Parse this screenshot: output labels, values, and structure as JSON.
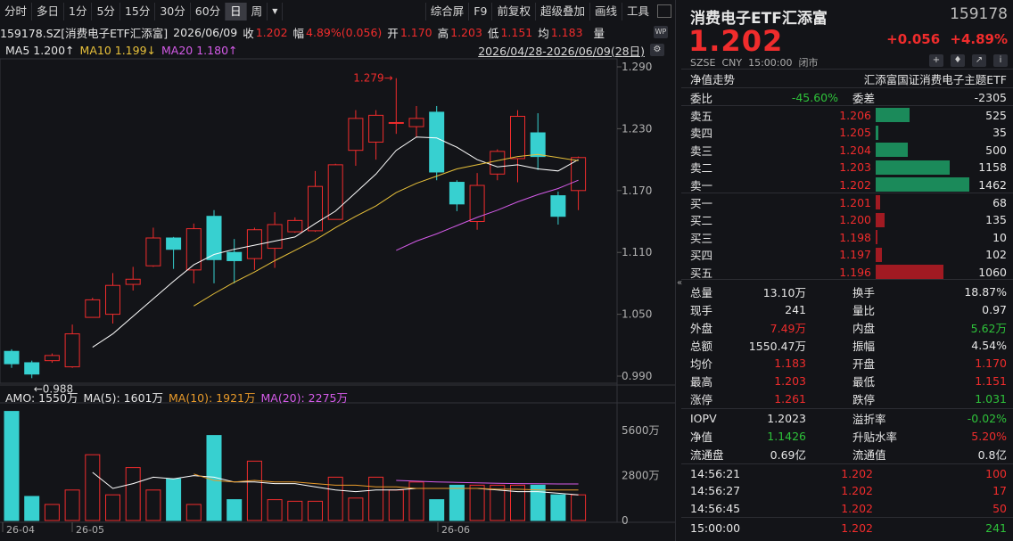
{
  "toolbar": {
    "left": [
      "分时",
      "多日",
      "1分",
      "5分",
      "15分",
      "30分",
      "60分",
      "日",
      "周"
    ],
    "active": "日",
    "right": [
      "综合屏",
      "F9",
      "前复权",
      "超级叠加",
      "画线",
      "工具"
    ]
  },
  "info": {
    "code": "159178.SZ[消费电子ETF汇添富]",
    "date": "2026/06/09",
    "close_label": "收",
    "close": "1.202",
    "amp_label": "幅",
    "amp": "4.89%(0.056)",
    "open_label": "开",
    "open": "1.170",
    "high_label": "高",
    "high": "1.203",
    "low_label": "低",
    "low": "1.151",
    "avg_label": "均",
    "avg": "1.183",
    "vol_label": "量"
  },
  "ma": {
    "ma5": "MA5 1.200↑",
    "ma10": "MA10 1.199↓",
    "ma20": "MA20 1.180↑",
    "range": "2026/04/28-2026/06/09(28日)"
  },
  "amo": {
    "amo": "AMO: 1550万",
    "ma5": "MA(5): 1601万",
    "ma10": "MA(10): 1921万",
    "ma20": "MA(20): 2275万"
  },
  "chart_data": {
    "type": "candlestick",
    "price_axis": [
      "1.290",
      "1.230",
      "1.170",
      "1.110",
      "1.050",
      "0.990"
    ],
    "ylim": [
      0.96,
      1.3
    ],
    "vol_axis": [
      "5600万",
      "2800万",
      "0"
    ],
    "vol_ylim": [
      0,
      7000
    ],
    "x_labels": [
      "26-04",
      "26-05",
      "26-06"
    ],
    "annotations": {
      "high": "1.279",
      "low": "0.988"
    },
    "candles": [
      {
        "o": 1.014,
        "c": 1.002,
        "h": 1.016,
        "l": 0.998
      },
      {
        "o": 1.003,
        "c": 0.992,
        "h": 1.005,
        "l": 0.988
      },
      {
        "o": 1.005,
        "c": 1.01,
        "h": 1.012,
        "l": 1.003
      },
      {
        "o": 0.999,
        "c": 1.031,
        "h": 1.04,
        "l": 0.998
      },
      {
        "o": 1.047,
        "c": 1.064,
        "h": 1.066,
        "l": 1.047
      },
      {
        "o": 1.05,
        "c": 1.078,
        "h": 1.09,
        "l": 1.041
      },
      {
        "o": 1.079,
        "c": 1.084,
        "h": 1.096,
        "l": 1.073
      },
      {
        "o": 1.097,
        "c": 1.124,
        "h": 1.134,
        "l": 1.096
      },
      {
        "o": 1.124,
        "c": 1.113,
        "h": 1.125,
        "l": 1.094
      },
      {
        "o": 1.093,
        "c": 1.133,
        "h": 1.138,
        "l": 1.08
      },
      {
        "o": 1.145,
        "c": 1.103,
        "h": 1.151,
        "l": 1.08
      },
      {
        "o": 1.11,
        "c": 1.102,
        "h": 1.123,
        "l": 1.08
      },
      {
        "o": 1.104,
        "c": 1.132,
        "h": 1.134,
        "l": 1.093
      },
      {
        "o": 1.114,
        "c": 1.137,
        "h": 1.149,
        "l": 1.095
      },
      {
        "o": 1.13,
        "c": 1.141,
        "h": 1.144,
        "l": 1.129
      },
      {
        "o": 1.131,
        "c": 1.174,
        "h": 1.189,
        "l": 1.13
      },
      {
        "o": 1.142,
        "c": 1.195,
        "h": 1.196,
        "l": 1.142
      },
      {
        "o": 1.209,
        "c": 1.24,
        "h": 1.248,
        "l": 1.194
      },
      {
        "o": 1.217,
        "c": 1.243,
        "h": 1.248,
        "l": 1.2
      },
      {
        "o": 1.236,
        "c": 1.236,
        "h": 1.279,
        "l": 1.225
      },
      {
        "o": 1.232,
        "c": 1.24,
        "h": 1.252,
        "l": 1.222
      },
      {
        "o": 1.246,
        "c": 1.188,
        "h": 1.252,
        "l": 1.18
      },
      {
        "o": 1.178,
        "c": 1.157,
        "h": 1.18,
        "l": 1.15
      },
      {
        "o": 1.14,
        "c": 1.175,
        "h": 1.187,
        "l": 1.132
      },
      {
        "o": 1.186,
        "c": 1.208,
        "h": 1.21,
        "l": 1.18
      },
      {
        "o": 1.201,
        "c": 1.242,
        "h": 1.248,
        "l": 1.178
      },
      {
        "o": 1.226,
        "c": 1.203,
        "h": 1.245,
        "l": 1.19
      },
      {
        "o": 1.165,
        "c": 1.145,
        "h": 1.169,
        "l": 1.137
      },
      {
        "o": 1.17,
        "c": 1.202,
        "h": 1.203,
        "l": 1.151
      }
    ],
    "volumes": [
      6800,
      1500,
      1000,
      1900,
      4100,
      1600,
      3300,
      1900,
      2600,
      1000,
      5300,
      1300,
      3700,
      1300,
      1200,
      1200,
      2700,
      1400,
      2700,
      1900,
      2400,
      1300,
      2200,
      2200,
      2200,
      2200,
      2200,
      1600,
      1600
    ],
    "ma5": [
      null,
      null,
      null,
      null,
      1.018,
      1.031,
      1.048,
      1.065,
      1.082,
      1.098,
      1.108,
      1.113,
      1.117,
      1.121,
      1.125,
      1.138,
      1.15,
      1.168,
      1.186,
      1.209,
      1.222,
      1.221,
      1.212,
      1.2,
      1.193,
      1.195,
      1.191,
      1.189,
      1.2
    ],
    "ma10": [
      null,
      null,
      null,
      null,
      null,
      null,
      null,
      null,
      null,
      1.058,
      1.07,
      1.081,
      1.091,
      1.102,
      1.112,
      1.122,
      1.134,
      1.145,
      1.155,
      1.168,
      1.177,
      1.184,
      1.191,
      1.195,
      1.199,
      1.203,
      1.205,
      1.202,
      1.199
    ],
    "ma20": [
      null,
      null,
      null,
      null,
      null,
      null,
      null,
      null,
      null,
      null,
      null,
      null,
      null,
      null,
      null,
      null,
      null,
      null,
      null,
      1.112,
      1.121,
      1.128,
      1.136,
      1.144,
      1.151,
      1.159,
      1.166,
      1.172,
      1.18
    ],
    "vol_ma5": [
      null,
      null,
      null,
      null,
      3000,
      2000,
      2300,
      2700,
      2600,
      2800,
      2700,
      2400,
      2400,
      2300,
      2300,
      2100,
      1900,
      1800,
      1900,
      1900,
      2000,
      2000,
      2000,
      2000,
      1900,
      1800,
      1800,
      1700,
      1600
    ],
    "vol_ma10": [
      null,
      null,
      null,
      null,
      null,
      null,
      null,
      null,
      null,
      2900,
      2500,
      2400,
      2500,
      2400,
      2400,
      2300,
      2200,
      2200,
      2100,
      2100,
      2000,
      2000,
      2000,
      2000,
      1950,
      1950,
      1900,
      1900,
      1900
    ],
    "vol_ma20": [
      null,
      null,
      null,
      null,
      null,
      null,
      null,
      null,
      null,
      null,
      null,
      null,
      null,
      null,
      null,
      null,
      null,
      null,
      null,
      2500,
      2450,
      2400,
      2380,
      2350,
      2320,
      2300,
      2290,
      2280,
      2275
    ]
  },
  "colors": {
    "up": "#f02c2c",
    "down": "#37d0d0",
    "ma5": "#ffffff",
    "ma10": "#e8c13a",
    "ma20": "#d45be8",
    "vma10": "#e89a2a"
  },
  "quote": {
    "title": "消费电子ETF汇添富",
    "code": "159178",
    "price": "1.202",
    "change": "+0.056",
    "pct": "+4.89%",
    "exch": "SZSE",
    "cur": "CNY",
    "time": "15:00:00",
    "status": "闭市"
  },
  "nav": {
    "label": "净值走势",
    "name": "汇添富国证消费电子主题ETF"
  },
  "ratio": {
    "l1": "委比",
    "v1": "-45.60%",
    "l2": "委差",
    "v2": "-2305"
  },
  "asks": [
    {
      "label": "卖五",
      "price": "1.206",
      "vol": "525",
      "w": 525
    },
    {
      "label": "卖四",
      "price": "1.205",
      "vol": "35",
      "w": 35
    },
    {
      "label": "卖三",
      "price": "1.204",
      "vol": "500",
      "w": 500
    },
    {
      "label": "卖二",
      "price": "1.203",
      "vol": "1158",
      "w": 1158
    },
    {
      "label": "卖一",
      "price": "1.202",
      "vol": "1462",
      "w": 1462
    }
  ],
  "bids": [
    {
      "label": "买一",
      "price": "1.201",
      "vol": "68",
      "w": 68
    },
    {
      "label": "买二",
      "price": "1.200",
      "vol": "135",
      "w": 135
    },
    {
      "label": "买三",
      "price": "1.198",
      "vol": "10",
      "w": 10
    },
    {
      "label": "买四",
      "price": "1.197",
      "vol": "102",
      "w": 102
    },
    {
      "label": "买五",
      "price": "1.196",
      "vol": "1060",
      "w": 1060
    }
  ],
  "stats": [
    {
      "l1": "总量",
      "v1": "13.10万",
      "c1": "white",
      "l2": "换手",
      "v2": "18.87%",
      "c2": "white"
    },
    {
      "l1": "现手",
      "v1": "241",
      "c1": "white",
      "l2": "量比",
      "v2": "0.97",
      "c2": "white"
    },
    {
      "l1": "外盘",
      "v1": "7.49万",
      "c1": "red",
      "l2": "内盘",
      "v2": "5.62万",
      "c2": "green"
    },
    {
      "l1": "总额",
      "v1": "1550.47万",
      "c1": "white",
      "l2": "振幅",
      "v2": "4.54%",
      "c2": "white"
    },
    {
      "l1": "均价",
      "v1": "1.183",
      "c1": "red",
      "l2": "开盘",
      "v2": "1.170",
      "c2": "red"
    },
    {
      "l1": "最高",
      "v1": "1.203",
      "c1": "red",
      "l2": "最低",
      "v2": "1.151",
      "c2": "red"
    },
    {
      "l1": "涨停",
      "v1": "1.261",
      "c1": "red",
      "l2": "跌停",
      "v2": "1.031",
      "c2": "green"
    }
  ],
  "stats2": [
    {
      "l1": "IOPV",
      "v1": "1.2023",
      "c1": "white",
      "l2": "溢折率",
      "v2": "-0.02%",
      "c2": "green"
    },
    {
      "l1": "净值",
      "v1": "1.1426",
      "c1": "green",
      "l2": "升贴水率",
      "v2": "5.20%",
      "c2": "red"
    },
    {
      "l1": "流通盘",
      "v1": "0.69亿",
      "c1": "white",
      "l2": "流通值",
      "v2": "0.8亿",
      "c2": "white"
    }
  ],
  "ticks": [
    {
      "t": "14:56:21",
      "p": "1.202",
      "v": "100",
      "vc": "red"
    },
    {
      "t": "14:56:27",
      "p": "1.202",
      "v": "17",
      "vc": "red"
    },
    {
      "t": "14:56:45",
      "p": "1.202",
      "v": "50",
      "vc": "red"
    },
    {
      "t": "15:00:00",
      "p": "1.202",
      "v": "241",
      "vc": "green"
    }
  ]
}
